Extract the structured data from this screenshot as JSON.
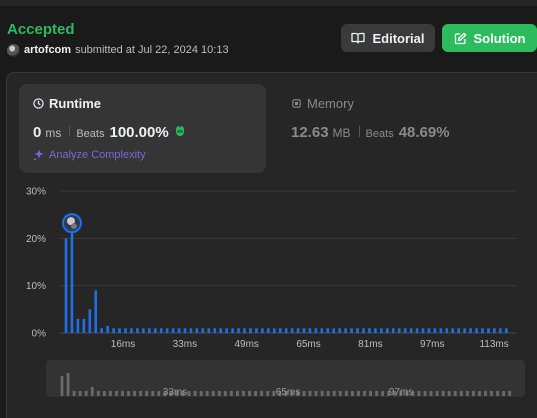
{
  "submission": {
    "status": "Accepted",
    "username": "artofcom",
    "submitted_text": "submitted at Jul 22, 2024 10:13"
  },
  "actions": {
    "editorial_label": "Editorial",
    "solution_label": "Solution"
  },
  "runtime": {
    "title": "Runtime",
    "value": "0",
    "unit": "ms",
    "beats_label": "Beats",
    "beats": "100.00%",
    "analyze_label": "Analyze Complexity"
  },
  "memory": {
    "title": "Memory",
    "value": "12.63",
    "unit": "MB",
    "beats_label": "Beats",
    "beats": "48.69%"
  },
  "icons": [
    "book-icon",
    "edit-icon",
    "clock-icon",
    "memory-chip-icon",
    "sparkle-icon",
    "clap-icon"
  ],
  "colors": {
    "accepted": "#2cbb5d",
    "bar": "#1f6feb",
    "solution_button": "#2cbb5d",
    "analyze": "#7a69d8"
  },
  "chart_data": {
    "type": "bar",
    "ylabel": "",
    "xlabel": "",
    "yticks": [
      "30%",
      "20%",
      "10%",
      "0%"
    ],
    "ylim": [
      0,
      30
    ],
    "xticks": [
      "16ms",
      "33ms",
      "49ms",
      "65ms",
      "81ms",
      "97ms",
      "113ms"
    ],
    "values": [
      20,
      23,
      3,
      3,
      5,
      9,
      1,
      1.5,
      1,
      1,
      1,
      1,
      1,
      1,
      1,
      1,
      1,
      1,
      1,
      1,
      1,
      1,
      1,
      1,
      1,
      1,
      1,
      1,
      1,
      1,
      1,
      1,
      1,
      1,
      1,
      1,
      1,
      1,
      1,
      1,
      1,
      1,
      1,
      1,
      1,
      1,
      1,
      1,
      1,
      1,
      1,
      1,
      1,
      1,
      1,
      1,
      1,
      1,
      1,
      1,
      1,
      1,
      1,
      1,
      1,
      1,
      1,
      1,
      1,
      1,
      1,
      1,
      1,
      1,
      1
    ],
    "highlight_index": 1,
    "navigator_ticks": [
      "33ms",
      "65ms",
      "97ms"
    ]
  }
}
